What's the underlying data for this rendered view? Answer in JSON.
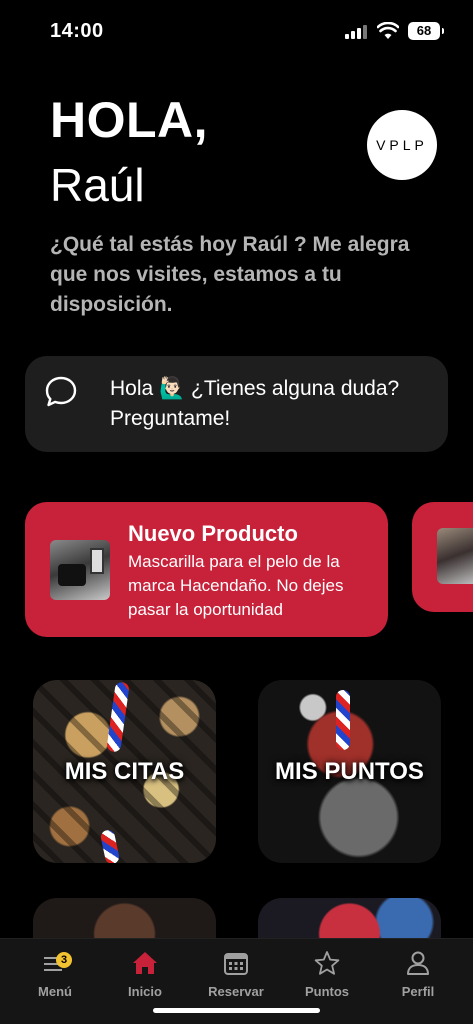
{
  "status_bar": {
    "time": "14:00",
    "battery": "68"
  },
  "greeting": {
    "title": "HOLA,",
    "name": "Raúl",
    "subtitle": "¿Qué tal estás hoy Raúl ? Me alegra que nos visites, estamos a tu disposición."
  },
  "brand": {
    "logo_text": "VPLP"
  },
  "chat": {
    "text": "Hola 🙋🏻‍♂️ ¿Tienes alguna duda? Preguntame!"
  },
  "promo": {
    "title": "Nuevo Producto",
    "description": "Mascarilla para el pelo de la marca Hacendaño. No dejes pasar la oportunidad"
  },
  "tiles": [
    {
      "label": "MIS CITAS"
    },
    {
      "label": "MIS PUNTOS"
    }
  ],
  "tab_bar": {
    "items": [
      {
        "label": "Menú",
        "icon": "menu-icon",
        "badge": "3"
      },
      {
        "label": "Inicio",
        "icon": "home-icon"
      },
      {
        "label": "Reservar",
        "icon": "calendar-icon"
      },
      {
        "label": "Puntos",
        "icon": "star-icon"
      },
      {
        "label": "Perfil",
        "icon": "person-icon"
      }
    ],
    "active_color": "#c8213a"
  },
  "colors": {
    "accent": "#c8213a",
    "badge": "#f2c230",
    "card_bg": "#1e1e1f"
  }
}
